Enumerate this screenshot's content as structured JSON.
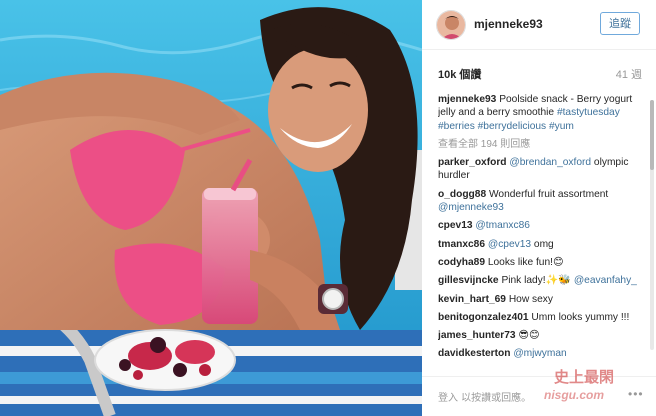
{
  "post": {
    "username": "mjenneke93",
    "follow_label": "追蹤",
    "likes": "10k 個讚",
    "age": "41 週",
    "caption": {
      "user": "mjenneke93",
      "text": "Poolside snack - Berry yogurt jelly and a berry smoothie",
      "hashtags": "#tastytuesday #berries #berrydelicious #yum"
    },
    "view_all_comments": "查看全部 194 則回應"
  },
  "comments": [
    {
      "user": "parker_oxford",
      "mention": "@brendan_oxford",
      "text": "olympic hurdler"
    },
    {
      "user": "o_dogg88",
      "text": "Wonderful fruit assortment",
      "mention": "@mjenneke93"
    },
    {
      "user": "cpev13",
      "mention": "@tmanxc86",
      "text": ""
    },
    {
      "user": "tmanxc86",
      "mention": "@cpev13",
      "text": "omg"
    },
    {
      "user": "codyha89",
      "text": "Looks like fun!😊"
    },
    {
      "user": "gillesvijncke",
      "text": "Pink lady!✨🐝",
      "mention": "@eavanfahy_"
    },
    {
      "user": "kevin_hart_69",
      "text": "How sexy"
    },
    {
      "user": "benitogonzalez401",
      "text": "Umm looks yummy !!!"
    },
    {
      "user": "james_hunter73",
      "text": "😎😊"
    },
    {
      "user": "davidkesterton",
      "mention": "@mjwyman",
      "text": ""
    }
  ],
  "footer": {
    "login_text": "登入 以按讚或回應。",
    "more_icon": "•••"
  },
  "watermark": {
    "line1": "史上最閑",
    "line2": "nisgu.com"
  },
  "colors": {
    "link": "#3f729b",
    "follow_border": "#70a9dc",
    "muted": "#999999",
    "pool": "#2fa7d6",
    "bikini": "#ec4f86",
    "smoothie": "#e04c7a"
  }
}
